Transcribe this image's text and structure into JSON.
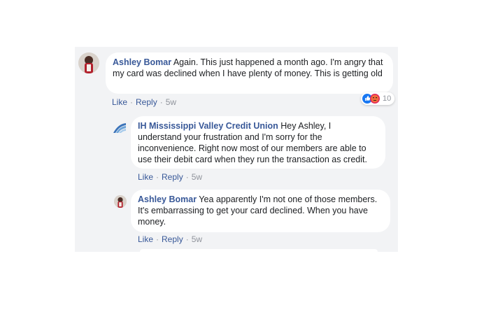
{
  "comments": [
    {
      "author": "Ashley Bomar",
      "text": " Again. This just happened a month ago. I'm angry that my card was declined when I have plenty of money. This is getting old",
      "actions": {
        "like": "Like",
        "reply": "Reply",
        "time": "5w"
      },
      "reactions": {
        "icons": [
          "like-icon",
          "angry-icon"
        ],
        "count": "10"
      }
    },
    {
      "author": "IH Mississippi Valley Credit Union",
      "text": " Hey Ashley, I understand your frustration and I'm sorry for the inconvenience. Right now most of our members are able to use their debit card when they run the transaction as credit.",
      "actions": {
        "like": "Like",
        "reply": "Reply",
        "time": "5w"
      }
    },
    {
      "author": "Ashley Bomar",
      "text": " Yea apparently I'm not one of those members. It's embarrassing to get your card declined. When you have money.",
      "actions": {
        "like": "Like",
        "reply": "Reply",
        "time": "5w"
      }
    }
  ],
  "colors": {
    "link": "#385898",
    "background": "#f2f3f5",
    "like_blue": "#1877f2",
    "angry_red": "#e9710f"
  }
}
